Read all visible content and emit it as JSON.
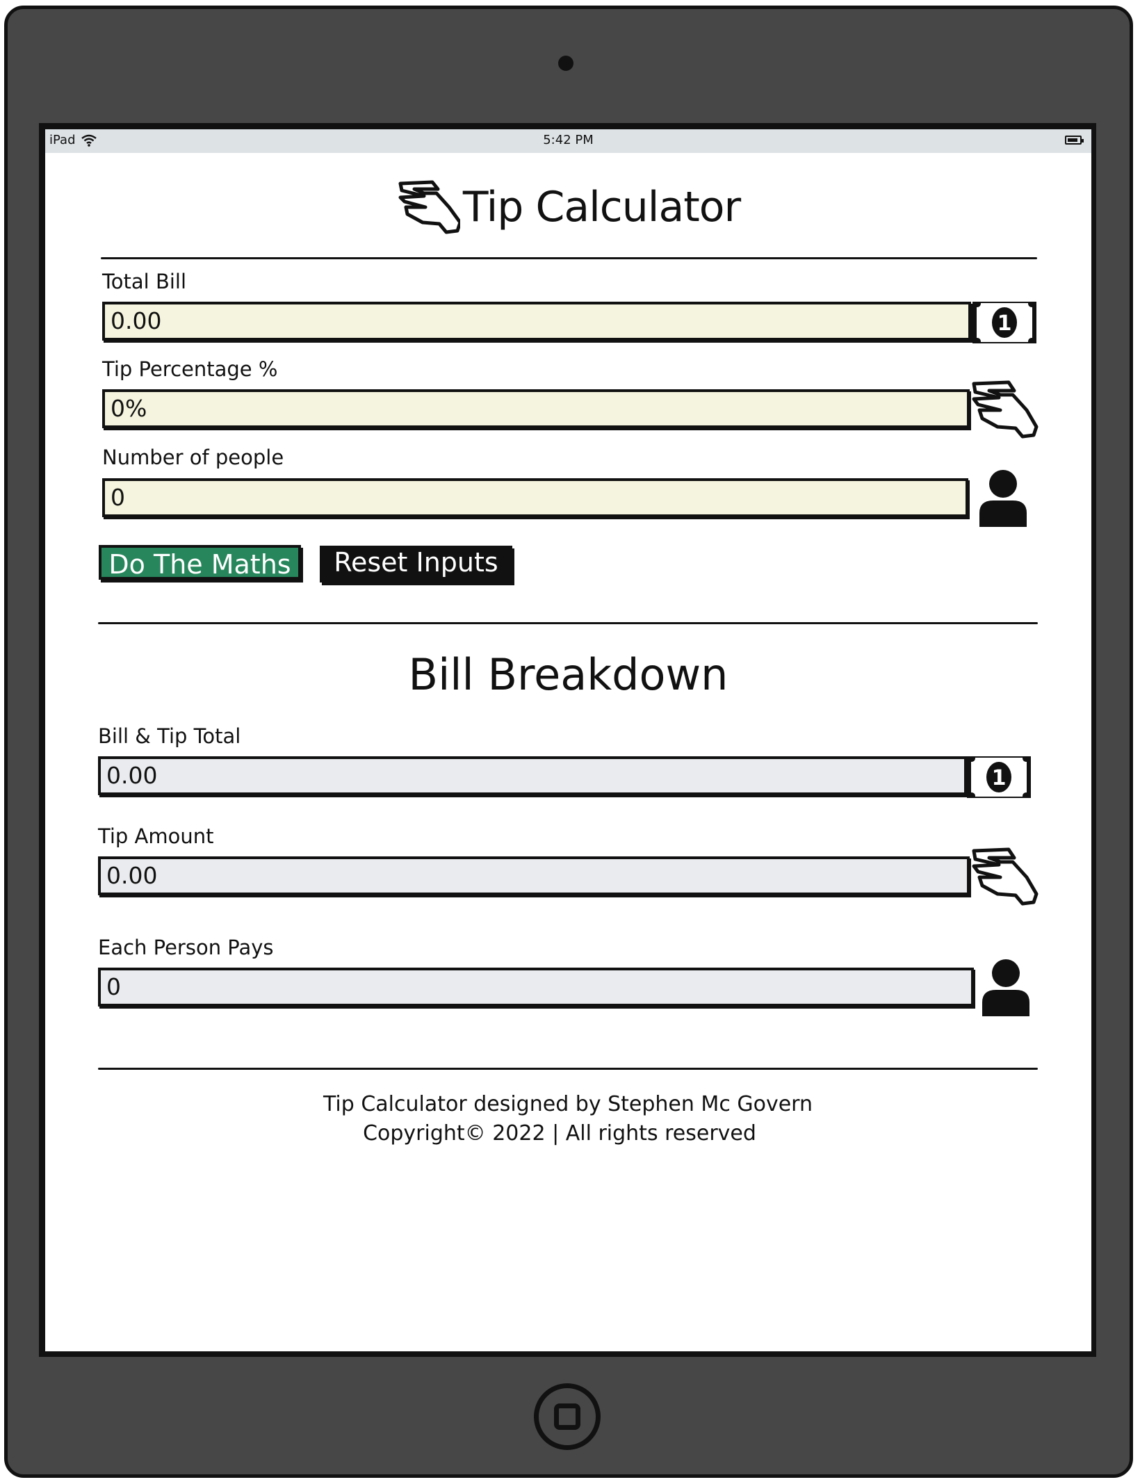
{
  "status_bar": {
    "device": "iPad",
    "time": "5:42 PM"
  },
  "header": {
    "title": "Tip Calculator"
  },
  "inputs": {
    "total_bill": {
      "label": "Total Bill",
      "value": "0.00"
    },
    "tip_percentage": {
      "label": "Tip Percentage %",
      "value": "0%"
    },
    "people": {
      "label": "Number of people",
      "value": "0"
    }
  },
  "buttons": {
    "calculate": "Do The Maths",
    "reset": "Reset Inputs"
  },
  "breakdown": {
    "title": "Bill Breakdown",
    "bill_tip_total": {
      "label": "Bill & Tip Total",
      "value": "0.00"
    },
    "tip_amount": {
      "label": "Tip Amount",
      "value": "0.00"
    },
    "each_person": {
      "label": "Each Person Pays",
      "value": "0"
    }
  },
  "footer": {
    "line1": "Tip Calculator designed by Stephen Mc Govern",
    "line2": "Copyright© 2022 | All rights reserved"
  },
  "icons": {
    "money": "money-bill-icon",
    "tip": "tip-hand-icon",
    "person": "person-icon",
    "wifi": "wifi-icon",
    "battery": "battery-icon"
  },
  "colors": {
    "calculate_button": "#27865c",
    "input_bg": "#f5f4de",
    "output_bg": "#e9ebee",
    "device": "#474747"
  }
}
